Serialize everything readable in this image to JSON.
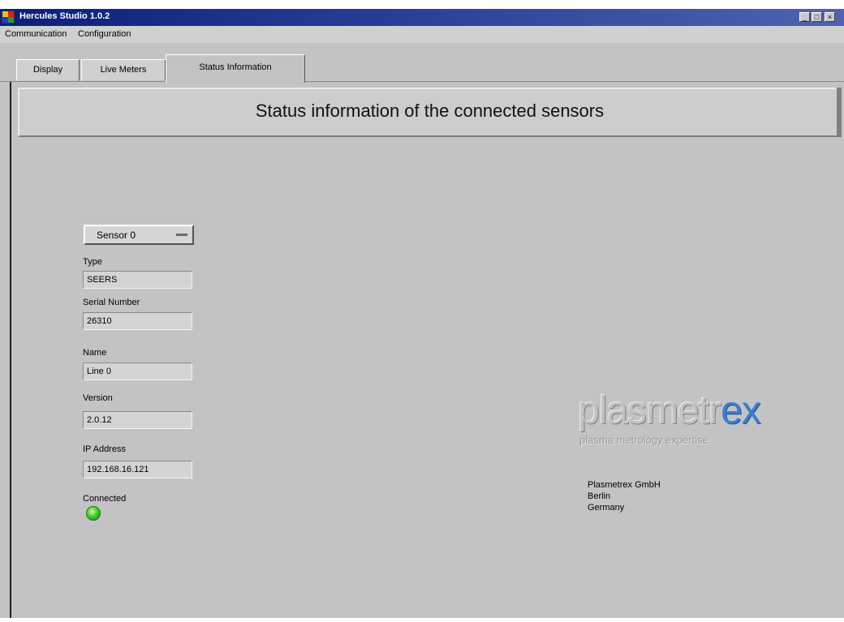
{
  "window": {
    "title": "Hercules Studio 1.0.2",
    "min_label": "_",
    "max_label": "□",
    "close_label": "×"
  },
  "menu": {
    "items": [
      "Communication",
      "Configuration"
    ]
  },
  "tabs": [
    {
      "label": "Display",
      "active": false
    },
    {
      "label": "Live Meters",
      "active": false
    },
    {
      "label": "Status Information",
      "active": true
    }
  ],
  "banner": {
    "title": "Status information of the connected sensors"
  },
  "sensor_select": {
    "value": "Sensor 0"
  },
  "fields": {
    "type": {
      "label": "Type",
      "value": "SEERS"
    },
    "serial": {
      "label": "Serial Number",
      "value": "26310"
    },
    "name": {
      "label": "Name",
      "value": "Line 0"
    },
    "version": {
      "label": "Version",
      "value": "2.0.12"
    },
    "ip": {
      "label": "IP Address",
      "value": "192.168.16.121"
    },
    "connected": {
      "label": "Connected",
      "state": "on",
      "led_color": "#3fd02a"
    }
  },
  "logo": {
    "text_main": "plasmetr",
    "text_accent": "ex",
    "tagline": "plasma metrology expertise"
  },
  "company": {
    "lines": [
      "Plasmetrex GmbH",
      "Berlin",
      "Germany"
    ]
  },
  "colors": {
    "background": "#c3c3c3",
    "titlebar": "#0b1f7a",
    "accent": "#3a7dd8"
  }
}
